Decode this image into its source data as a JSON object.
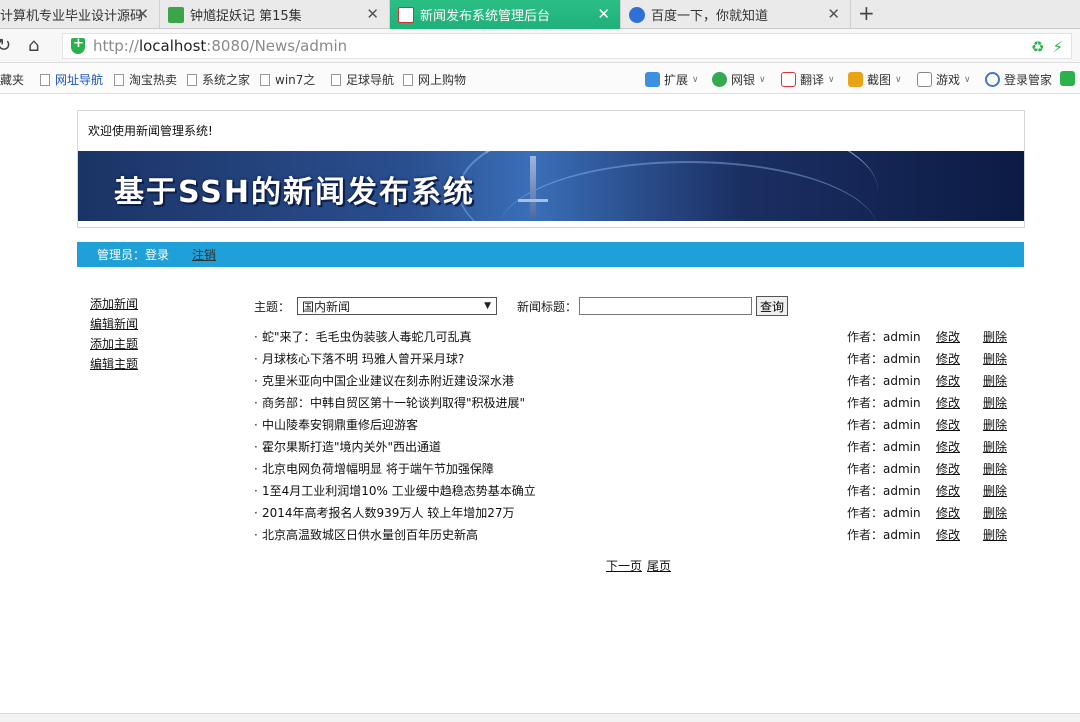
{
  "browser": {
    "tabs": [
      {
        "label": "计算机专业毕业设计源码",
        "active": false,
        "icon": "page-icon"
      },
      {
        "label": "钟馗捉妖记 第15集",
        "active": false,
        "icon": "video-icon"
      },
      {
        "label": "新闻发布系统管理后台",
        "active": true,
        "icon": "site-icon"
      },
      {
        "label": "百度一下，你就知道",
        "active": false,
        "icon": "baidu-paw-icon"
      }
    ],
    "new_tab": "+",
    "url": {
      "scheme": "http://",
      "host": "localhost",
      "rest": ":8080/News/admin"
    },
    "bookmarks": [
      {
        "label": "收藏夹"
      },
      {
        "label": "网址导航"
      },
      {
        "label": "淘宝热卖"
      },
      {
        "label": "系统之家"
      },
      {
        "label": "win7之"
      },
      {
        "label": "足球导航"
      },
      {
        "label": "网上购物"
      }
    ],
    "tools": [
      {
        "label": "扩展"
      },
      {
        "label": "网银"
      },
      {
        "label": "翻译"
      },
      {
        "label": "截图"
      },
      {
        "label": "游戏"
      },
      {
        "label": "登录管家"
      }
    ]
  },
  "page": {
    "welcome": "欢迎使用新闻管理系统!",
    "banner_title": "基于SSH的新闻发布系统",
    "admin_bar": {
      "label": "管理员：",
      "login": "登录",
      "logout": "注销"
    },
    "left_nav": [
      "添加新闻",
      "编辑新闻",
      "添加主题",
      "编辑主题"
    ],
    "search": {
      "topic_label": "主题：",
      "topic_selected": "国内新闻",
      "title_label": "新闻标题：",
      "title_value": "",
      "button": "查询"
    },
    "news": [
      {
        "title": "蛇\"来了：毛毛虫伪装骇人毒蛇几可乱真",
        "author": "admin"
      },
      {
        "title": "月球核心下落不明 玛雅人曾开采月球?",
        "author": "admin"
      },
      {
        "title": "克里米亚向中国企业建议在刻赤附近建设深水港",
        "author": "admin"
      },
      {
        "title": "商务部：中韩自贸区第十一轮谈判取得\"积极进展\"",
        "author": "admin"
      },
      {
        "title": "中山陵奉安铜鼎重修后迎游客",
        "author": "admin"
      },
      {
        "title": "霍尔果斯打造\"境内关外\"西出通道",
        "author": "admin"
      },
      {
        "title": "北京电网负荷增幅明显 将于端午节加强保障",
        "author": "admin"
      },
      {
        "title": "1至4月工业利润增10% 工业缓中趋稳态势基本确立",
        "author": "admin"
      },
      {
        "title": "2014年高考报名人数939万人 较上年增加27万",
        "author": "admin"
      },
      {
        "title": "北京高温致城区日供水量创百年历史新高",
        "author": "admin"
      }
    ],
    "row_labels": {
      "bullet": "·",
      "author_label": "作者：",
      "edit": "修改",
      "delete": "删除"
    },
    "pager": {
      "next": "下一页",
      "last": "尾页"
    }
  }
}
